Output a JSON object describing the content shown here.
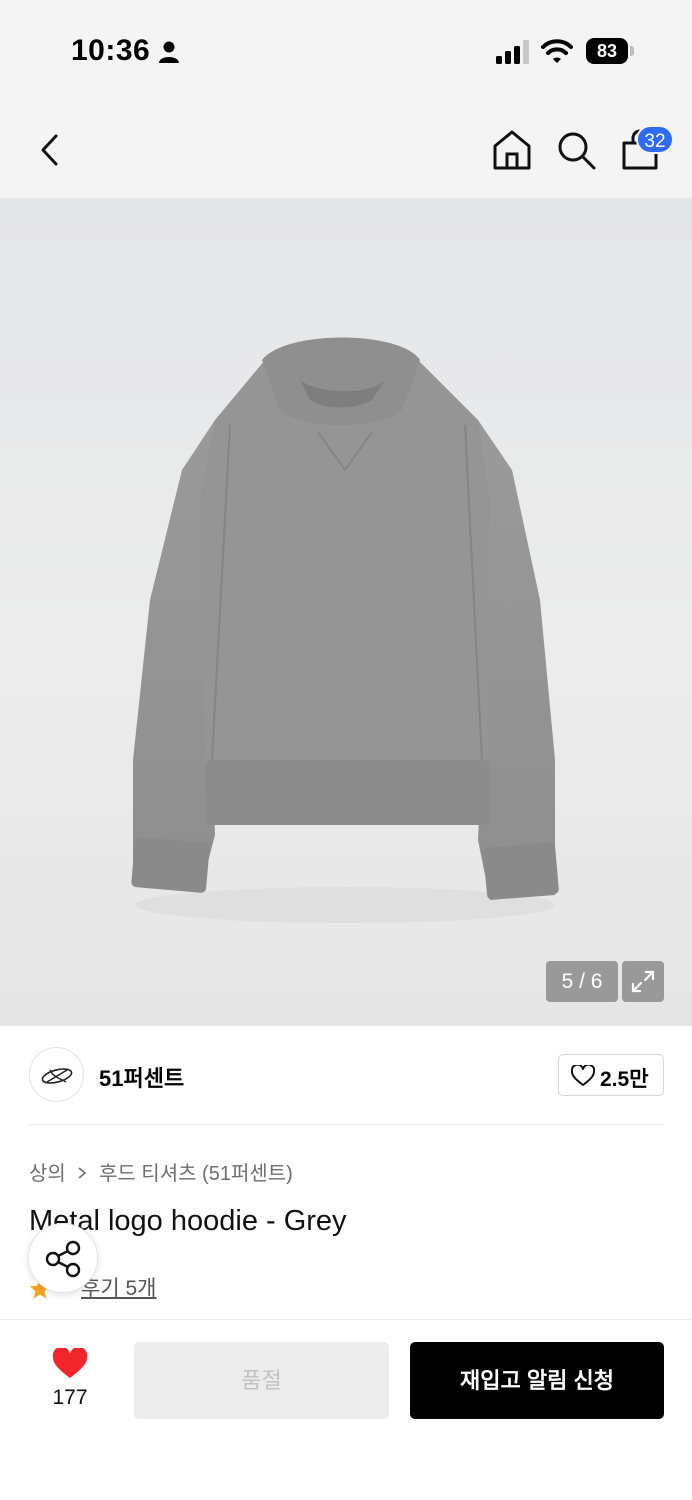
{
  "status_bar": {
    "time": "10:36",
    "battery": "83",
    "icons": [
      "person-icon",
      "signal-icon",
      "wifi-icon",
      "battery-icon"
    ]
  },
  "nav": {
    "icons": [
      "back-icon",
      "home-icon",
      "search-icon",
      "cart-icon"
    ],
    "cart_badge": "32"
  },
  "gallery": {
    "counter": "5 / 6",
    "icons": [
      "expand-icon"
    ]
  },
  "brand": {
    "name": "51퍼센트",
    "like_count": "2.5만",
    "icons": [
      "brand-logo-icon",
      "heart-outline-icon"
    ]
  },
  "breadcrumb": {
    "category": "상의",
    "subcategory": "후드 티셔츠 (51퍼센트)",
    "separator_icon": "chevron-right-icon"
  },
  "product": {
    "title": "Metal logo hoodie - Grey",
    "review_text": "후기 5개",
    "rating_icon": "star-icon"
  },
  "share": {
    "icon": "share-icon"
  },
  "bottom_bar": {
    "wish_count": "177",
    "soldout_label": "품절",
    "restock_label": "재입고 알림 신청",
    "icons": [
      "heart-filled-icon"
    ]
  },
  "colors": {
    "accent_badge": "#2f6cf6",
    "heart_red": "#f0262b",
    "star_gold": "#f5a623",
    "primary_button": "#000000",
    "disabled_button": "#ececec"
  }
}
